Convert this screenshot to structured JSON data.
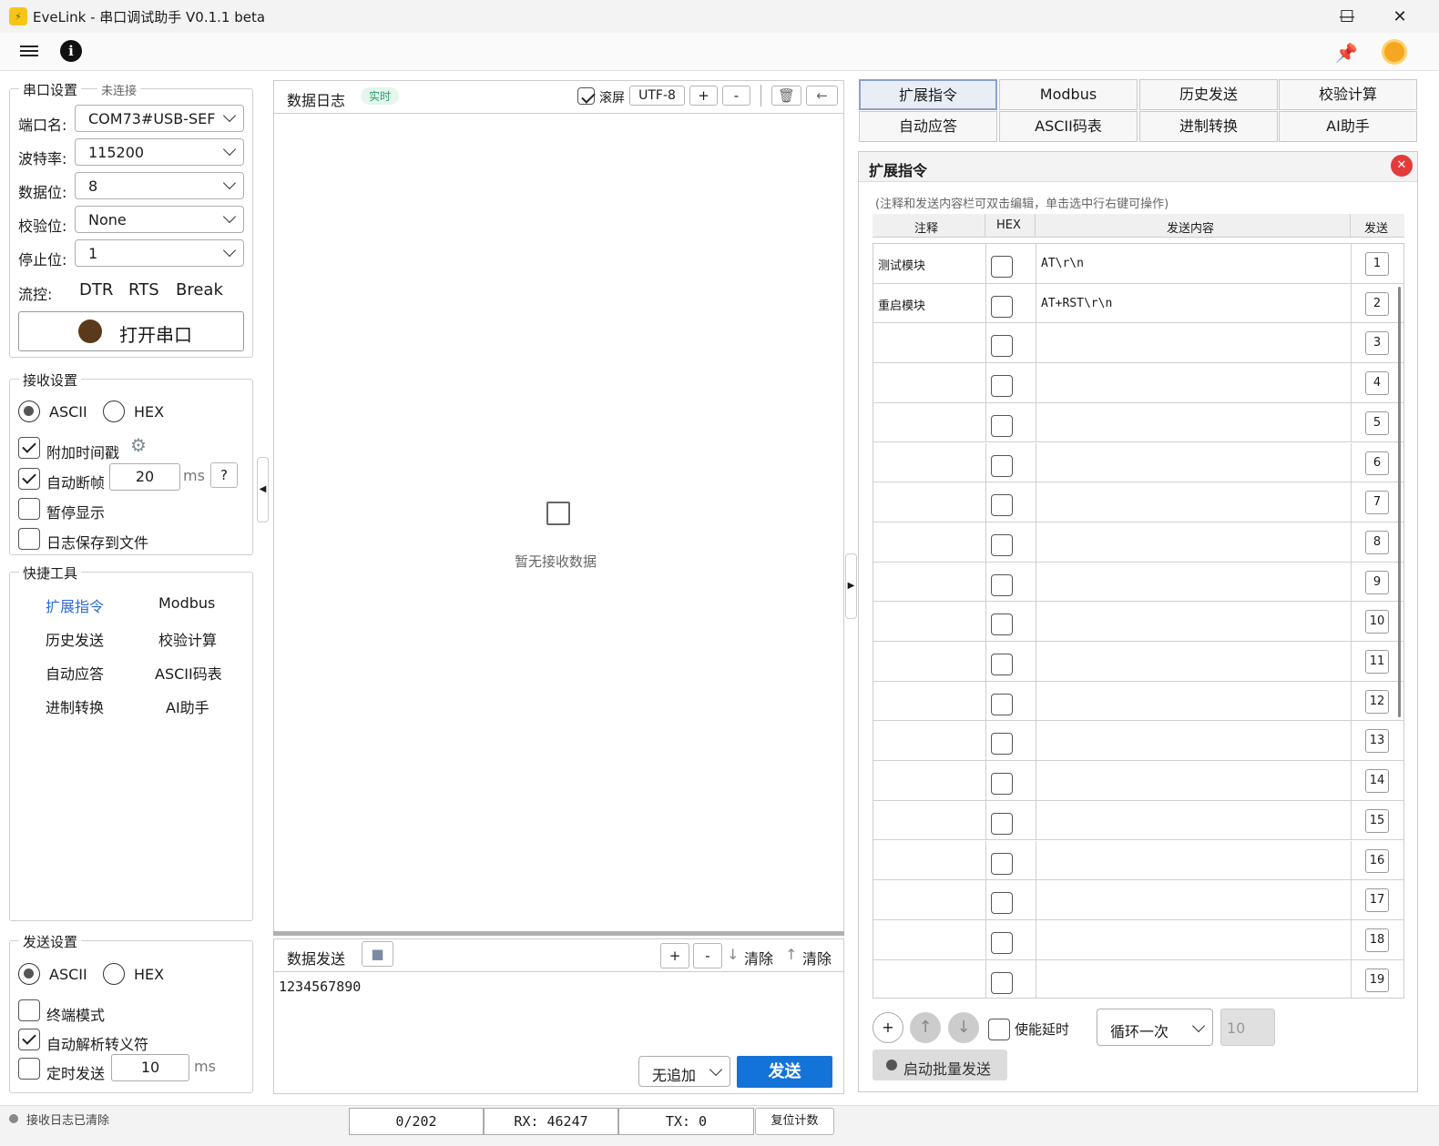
{
  "window": {
    "title": "EveLink - 串口调试助手 V0.1.1 beta",
    "minimize": "—",
    "maximize": "☐",
    "close": "✕"
  },
  "serial": {
    "legend": "串口设置",
    "status": "未连接",
    "port_label": "端口名:",
    "port_value": "COM73#USB-SEF",
    "baud_label": "波特率:",
    "baud_value": "115200",
    "databits_label": "数据位:",
    "databits_value": "8",
    "parity_label": "校验位:",
    "parity_value": "None",
    "stopbits_label": "停止位:",
    "stopbits_value": "1",
    "flow_label": "流控:",
    "dtr": "DTR",
    "rts": "RTS",
    "break": "Break",
    "open_label": "打开串口"
  },
  "receive": {
    "legend": "接收设置",
    "ascii": "ASCII",
    "hex": "HEX",
    "timestamp": "附加时间戳",
    "autoframe": "自动断帧",
    "frame_ms": "20",
    "ms": "ms",
    "help": "?",
    "pause": "暂停显示",
    "savelog": "日志保存到文件"
  },
  "tools": {
    "legend": "快捷工具",
    "items": [
      "扩展指令",
      "Modbus",
      "历史发送",
      "校验计算",
      "自动应答",
      "ASCII码表",
      "进制转换",
      "AI助手"
    ]
  },
  "send_settings": {
    "legend": "发送设置",
    "ascii": "ASCII",
    "hex": "HEX",
    "terminal": "终端模式",
    "escape": "自动解析转义符",
    "timed": "定时发送",
    "timed_ms": "10",
    "ms": "ms"
  },
  "log": {
    "title": "数据日志",
    "badge": "实时",
    "scroll": "滚屏",
    "encoding": "UTF-8",
    "plus": "+",
    "minus": "-",
    "empty": "暂无接收数据"
  },
  "send": {
    "title": "数据发送",
    "plus": "+",
    "minus": "-",
    "clear1": "清除",
    "clear2": "清除",
    "content": "1234567890",
    "append": "无追加",
    "send_btn": "发送"
  },
  "tabs": [
    "扩展指令",
    "Modbus",
    "历史发送",
    "校验计算",
    "自动应答",
    "ASCII码表",
    "进制转换",
    "AI助手"
  ],
  "ext": {
    "title": "扩展指令",
    "hint": "(注释和发送内容栏可双击编辑，单击选中行右键可操作)",
    "col_comment": "注释",
    "col_hex": "HEX",
    "col_content": "发送内容",
    "col_send": "发送",
    "rows": [
      {
        "comment": "测试模块",
        "content": "AT\\r\\n",
        "num": "1"
      },
      {
        "comment": "重启模块",
        "content": "AT+RST\\r\\n",
        "num": "2"
      },
      {
        "comment": "",
        "content": "",
        "num": "3"
      },
      {
        "comment": "",
        "content": "",
        "num": "4"
      },
      {
        "comment": "",
        "content": "",
        "num": "5"
      },
      {
        "comment": "",
        "content": "",
        "num": "6"
      },
      {
        "comment": "",
        "content": "",
        "num": "7"
      },
      {
        "comment": "",
        "content": "",
        "num": "8"
      },
      {
        "comment": "",
        "content": "",
        "num": "9"
      },
      {
        "comment": "",
        "content": "",
        "num": "10"
      },
      {
        "comment": "",
        "content": "",
        "num": "11"
      },
      {
        "comment": "",
        "content": "",
        "num": "12"
      },
      {
        "comment": "",
        "content": "",
        "num": "13"
      },
      {
        "comment": "",
        "content": "",
        "num": "14"
      },
      {
        "comment": "",
        "content": "",
        "num": "15"
      },
      {
        "comment": "",
        "content": "",
        "num": "16"
      },
      {
        "comment": "",
        "content": "",
        "num": "17"
      },
      {
        "comment": "",
        "content": "",
        "num": "18"
      },
      {
        "comment": "",
        "content": "",
        "num": "19"
      }
    ],
    "add": "+",
    "up": "↑",
    "down": "↓",
    "delay": "使能延时",
    "loop": "循环一次",
    "loop_count": "10",
    "batch": "启动批量发送"
  },
  "status": {
    "message": "接收日志已清除",
    "count": "0/202",
    "rx": "RX: 46247",
    "tx": "TX: 0",
    "reset": "复位计数"
  }
}
